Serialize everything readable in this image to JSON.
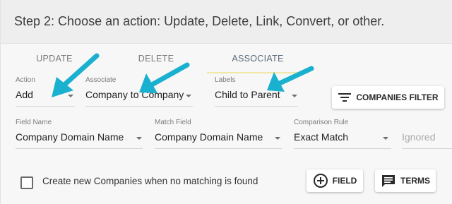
{
  "step": {
    "title": "Step 2: Choose an action: Update, Delete, Link, Convert, or other."
  },
  "tabs": [
    {
      "label": "UPDATE"
    },
    {
      "label": "DELETE"
    },
    {
      "label": "ASSOCIATE",
      "active": true
    }
  ],
  "row1": {
    "action": {
      "label": "Action",
      "value": "Add"
    },
    "associate": {
      "label": "Associate",
      "value": "Company to Company"
    },
    "labels": {
      "label": "Labels",
      "value": "Child to Parent"
    },
    "companies_filter": {
      "label": "COMPANIES FILTER",
      "icon": "filter-icon"
    }
  },
  "row2": {
    "field_name": {
      "label": "Field Name",
      "value": "Company Domain Name"
    },
    "match_field": {
      "label": "Match Field",
      "value": "Company Domain Name"
    },
    "comparison_rule": {
      "label": "Comparison Rule",
      "value": "Exact Match"
    },
    "ignored": {
      "placeholder": "Ignored"
    }
  },
  "footer": {
    "create_checkbox_label": "Create new Companies when no matching is found",
    "field_button": {
      "label": "FIELD",
      "icon": "add-circle-icon"
    },
    "terms_button": {
      "label": "TERMS",
      "icon": "comment-icon"
    }
  },
  "colors": {
    "arrow": "#1ab0cf",
    "active_tab_underline": "#f2e8a6"
  }
}
